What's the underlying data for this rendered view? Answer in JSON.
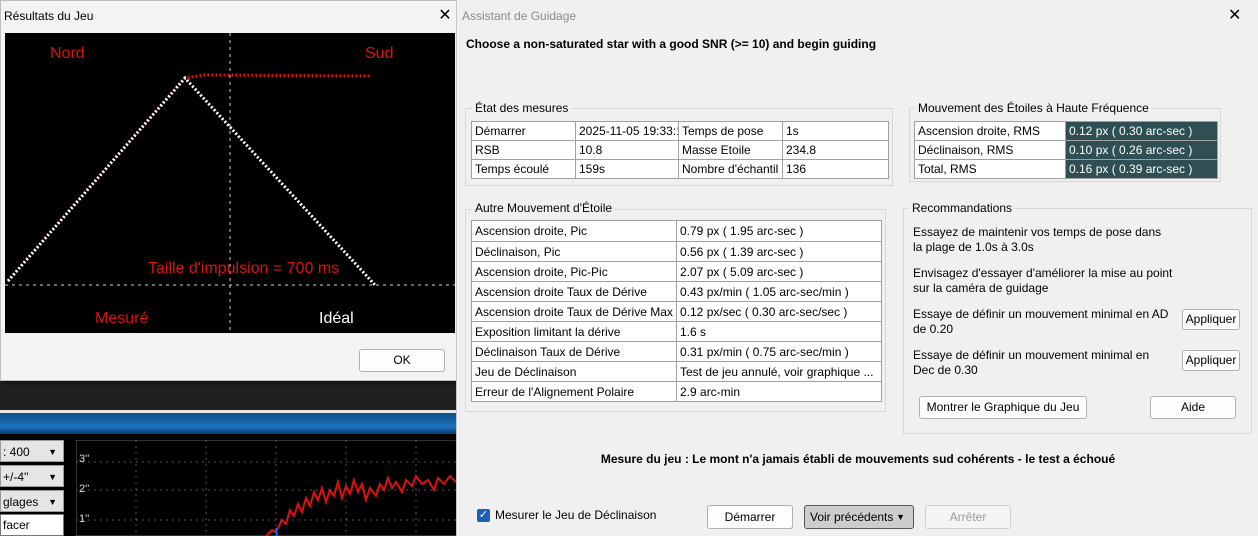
{
  "results_dialog": {
    "title": "Résultats du Jeu",
    "close_glyph": "✕",
    "label_north": "Nord",
    "label_south": "Sud",
    "pulse_label": "Taille d'impulsion = 700 ms",
    "legend_measured": "Mesuré",
    "legend_ideal": "Idéal",
    "ok_label": "OK",
    "colors": {
      "measured": "#e01010",
      "ideal": "#ffffff",
      "grid": "#cfcfcf"
    }
  },
  "background_window": {
    "controls": [
      {
        "label": ": 400"
      },
      {
        "label": "+/-4''"
      },
      {
        "label": "glages"
      }
    ],
    "erase_label": "facer",
    "y_ticks": [
      "3''",
      "2''",
      "1''"
    ]
  },
  "assistant": {
    "title": "Assistant de Guidage",
    "close_glyph": "✕",
    "instruction": "Choose a non-saturated star with a good SNR (>= 10) and begin guiding",
    "measurement_state": {
      "label": "État des mesures",
      "rows": [
        [
          "Démarrer",
          "2025-11-05 19:33:1",
          "Temps de pose",
          "1s"
        ],
        [
          "RSB",
          "10.8",
          "Masse Etoile",
          "234.8"
        ],
        [
          "Temps écoulé",
          "159s",
          "Nombre d'échantil",
          "136"
        ]
      ]
    },
    "high_freq": {
      "label": "Mouvement des Étoiles à Haute Fréquence",
      "rows": [
        [
          "Ascension droite, RMS",
          "0.12 px (  0.30 arc-sec )"
        ],
        [
          "Déclinaison, RMS",
          "0.10 px (  0.26 arc-sec )"
        ],
        [
          "Total, RMS",
          "0.16 px (  0.39 arc-sec )"
        ]
      ]
    },
    "other_motion": {
      "label": "Autre Mouvement d'Étoile",
      "rows": [
        [
          "Ascension droite, Pic",
          "0.79 px (  1.95 arc-sec )"
        ],
        [
          "Déclinaison, Pic",
          "0.56 px (  1.39 arc-sec )"
        ],
        [
          "Ascension droite, Pic-Pic",
          "2.07 px (  5.09 arc-sec )"
        ],
        [
          "Ascension droite Taux de Dérive",
          "0.43 px/min (  1.05 arc-sec/min )"
        ],
        [
          "Ascension droite Taux de Dérive Max",
          "0.12 px/sec (  0.30 arc-sec/sec )"
        ],
        [
          "Exposition limitant la dérive",
          "  1.6 s"
        ],
        [
          "Déclinaison Taux de Dérive",
          "0.31 px/min (  0.75 arc-sec/min )"
        ],
        [
          "Jeu de Déclinaison",
          "Test de jeu annulé, voir graphique ..."
        ],
        [
          "Erreur de l'Alignement Polaire",
          "2.9 arc-min"
        ]
      ]
    },
    "recommendations": {
      "label": "Recommandations",
      "items": [
        {
          "text": "Essayez de maintenir vos temps de pose dans la plage de 1.0s à 3.0s"
        },
        {
          "text": "Envisagez d'essayer d'améliorer la mise au point sur la caméra de guidage"
        },
        {
          "text": "Essaye de définir un mouvement minimal en AD de 0.20",
          "button": "Appliquer"
        },
        {
          "text": "Essaye de définir un mouvement minimal en Dec de 0.30",
          "button": "Appliquer"
        }
      ],
      "show_graph_button": "Montrer le Graphique du Jeu",
      "help_button": "Aide"
    },
    "verdict": "Mesure du jeu : Le mont n'a jamais établi de mouvements sud cohérents - le test a échoué",
    "checkbox": {
      "label": "Mesurer le Jeu de Déclinaison",
      "checked": true,
      "glyph": "✓"
    },
    "buttons": {
      "start": "Démarrer",
      "previous": "Voir précédents",
      "stop": "Arrêter"
    }
  }
}
